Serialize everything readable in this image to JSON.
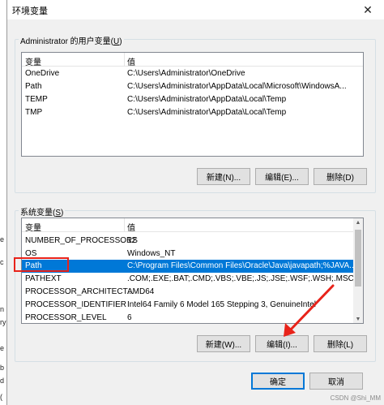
{
  "window": {
    "title": "环境变量",
    "close_icon": "close-icon"
  },
  "user_vars": {
    "group_label_prefix": "Administrator 的用户变量(",
    "group_label_key": "U",
    "group_label_suffix": ")",
    "columns": [
      "变量",
      "值"
    ],
    "rows": [
      {
        "name": "OneDrive",
        "value": "C:\\Users\\Administrator\\OneDrive"
      },
      {
        "name": "Path",
        "value": "C:\\Users\\Administrator\\AppData\\Local\\Microsoft\\WindowsA..."
      },
      {
        "name": "TEMP",
        "value": "C:\\Users\\Administrator\\AppData\\Local\\Temp"
      },
      {
        "name": "TMP",
        "value": "C:\\Users\\Administrator\\AppData\\Local\\Temp"
      }
    ],
    "buttons": {
      "new": "新建(N)...",
      "edit": "编辑(E)...",
      "delete": "删除(D)"
    }
  },
  "system_vars": {
    "group_label_prefix": "系统变量(",
    "group_label_key": "S",
    "group_label_suffix": ")",
    "columns": [
      "变量",
      "值"
    ],
    "rows": [
      {
        "name": "NUMBER_OF_PROCESSORS",
        "value": "12"
      },
      {
        "name": "OS",
        "value": "Windows_NT"
      },
      {
        "name": "Path",
        "value": "C:\\Program Files\\Common Files\\Oracle\\Java\\javapath;%JAVA..."
      },
      {
        "name": "PATHEXT",
        "value": ".COM;.EXE;.BAT;.CMD;.VBS;.VBE;.JS;.JSE;.WSF;.WSH;.MSC"
      },
      {
        "name": "PROCESSOR_ARCHITECT...",
        "value": "AMD64"
      },
      {
        "name": "PROCESSOR_IDENTIFIER",
        "value": "Intel64 Family 6 Model 165 Stepping 3, GenuineIntel"
      },
      {
        "name": "PROCESSOR_LEVEL",
        "value": "6"
      }
    ],
    "selected_row": "Path",
    "buttons": {
      "new": "新建(W)...",
      "edit": "编辑(I)...",
      "delete": "删除(L)"
    }
  },
  "footer": {
    "ok": "确定",
    "cancel": "取消"
  },
  "watermark": "CSDN @Shi_MM",
  "annotation_color": "#e8231a",
  "selection_color": "#0078d7"
}
